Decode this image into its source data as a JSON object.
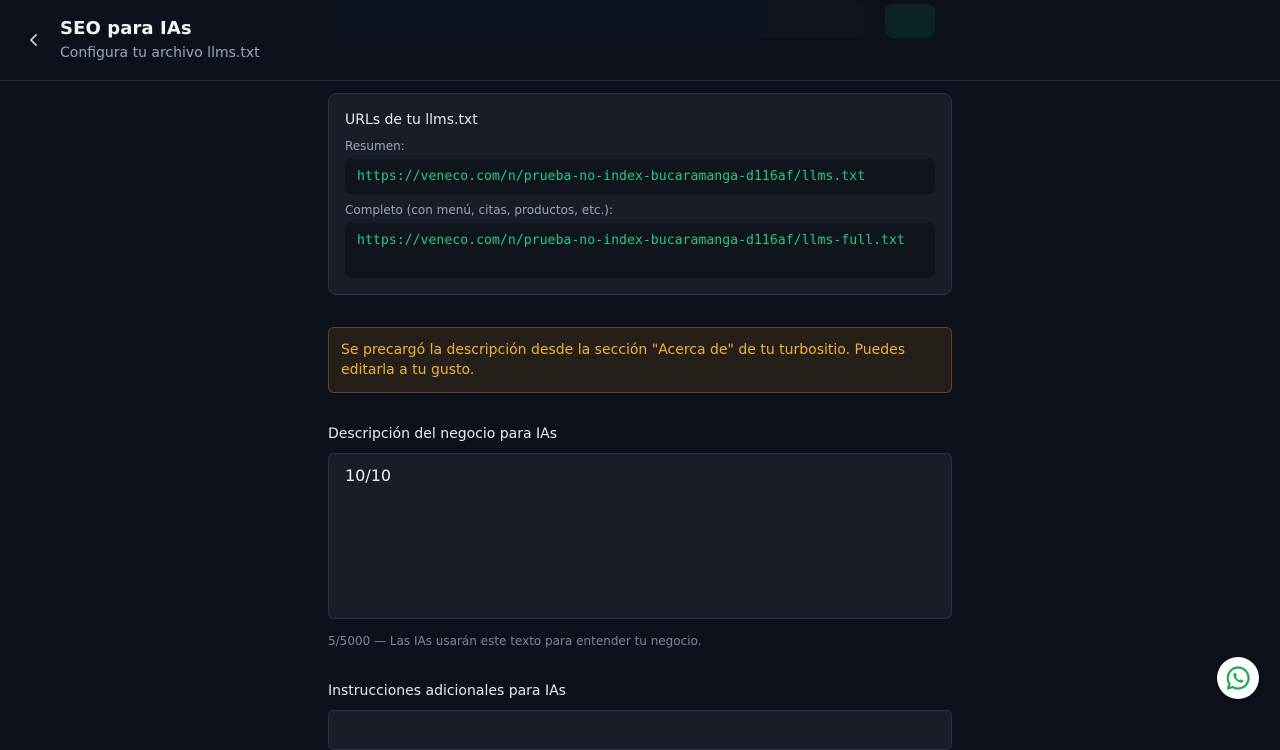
{
  "header": {
    "title": "SEO para IAs",
    "subtitle": "Configura tu archivo llms.txt",
    "back_icon": "chevron-left-icon"
  },
  "urls_card": {
    "title": "URLs de tu llms.txt",
    "summary_label": "Resumen:",
    "summary_url": "https://veneco.com/n/prueba-no-index-bucaramanga-d116af/llms.txt",
    "full_label": "Completo (con menú, citas, productos, etc.):",
    "full_url": "https://veneco.com/n/prueba-no-index-bucaramanga-d116af/llms-full.txt"
  },
  "alert": {
    "text": "Se precargó la descripción desde la sección \"Acerca de\" de tu turbositio. Puedes editarla a tu gusto."
  },
  "description_field": {
    "label": "Descripción del negocio para IAs",
    "value": "10/10",
    "helper": "5/5000 — Las IAs usarán este texto para entender tu negocio."
  },
  "instructions_field": {
    "label": "Instrucciones adicionales para IAs"
  },
  "whatsapp": {
    "icon": "whatsapp-icon"
  },
  "colors": {
    "background": "#0c111b",
    "card": "#181d28",
    "url_text": "#2bc58a",
    "alert_text": "#f0b03a",
    "whatsapp": "#25d366"
  }
}
